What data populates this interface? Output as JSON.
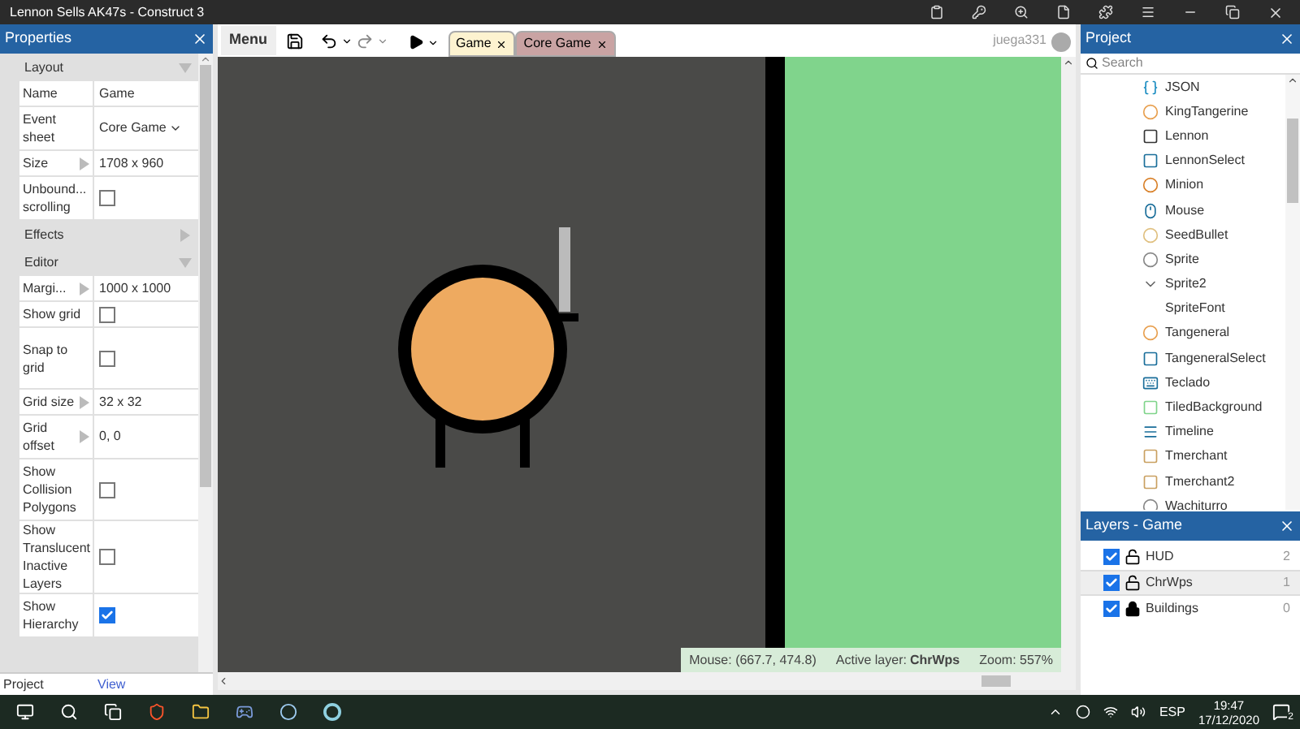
{
  "window": {
    "title": "Lennon Sells AK47s - Construct 3"
  },
  "properties": {
    "title": "Properties",
    "rows": [
      {
        "kind": "section",
        "label": "Layout",
        "expanded": true
      },
      {
        "kind": "text",
        "label": "Name",
        "value": "Game"
      },
      {
        "kind": "dropdown",
        "label": "Event sheet",
        "value": "Core Game"
      },
      {
        "kind": "expander",
        "label": "Size",
        "value": "1708 x 960"
      },
      {
        "kind": "checkbox",
        "label": "Unbound... scrolling",
        "checked": false
      },
      {
        "kind": "section",
        "label": "Effects",
        "expanded": false
      },
      {
        "kind": "section",
        "label": "Editor",
        "expanded": true
      },
      {
        "kind": "expander",
        "label": "Margi...",
        "value": "1000 x 1000"
      },
      {
        "kind": "checkbox",
        "label": "Show grid",
        "checked": false
      },
      {
        "kind": "checkbox",
        "label": "Snap to grid",
        "checked": false
      },
      {
        "kind": "expander",
        "label": "Grid size",
        "value": "32 x 32"
      },
      {
        "kind": "expander",
        "label": "Grid offset",
        "value": "0, 0"
      },
      {
        "kind": "checkbox",
        "label": "Show Collision Polygons",
        "checked": false
      },
      {
        "kind": "checkbox",
        "label": "Show Translucent Inactive Layers",
        "checked": false
      },
      {
        "kind": "checkbox",
        "label": "Show Hierarchy",
        "checked": true
      }
    ],
    "footer": "Project",
    "footer_link": "View"
  },
  "toolbar": {
    "menu": "Menu",
    "tabs": [
      {
        "label": "Game",
        "selected": true
      },
      {
        "label": "Core Game",
        "selected": false
      }
    ],
    "user": "juega331"
  },
  "status_bar": {
    "mouse": "Mouse: (667.7, 474.8)",
    "active_layer_label": "Active layer:",
    "active_layer": "ChrWps",
    "zoom": "Zoom: 557%"
  },
  "project": {
    "title": "Project",
    "search": {
      "placeholder": "Search"
    },
    "items": [
      "JSON",
      "KingTangerine",
      "Lennon",
      "LennonSelect",
      "Minion",
      "Mouse",
      "SeedBullet",
      "Sprite",
      "Sprite2",
      "SpriteFont",
      "Tangeneral",
      "TangeneralSelect",
      "Teclado",
      "TiledBackground",
      "Timeline",
      "Tmerchant",
      "Tmerchant2",
      "Wachiturro"
    ]
  },
  "layers": {
    "title": "Layers - Game",
    "items": [
      {
        "name": "HUD",
        "number": "2",
        "visible": true,
        "locked": false,
        "selected": false
      },
      {
        "name": "ChrWps",
        "number": "1",
        "visible": true,
        "locked": false,
        "selected": true
      },
      {
        "name": "Buildings",
        "number": "0",
        "visible": true,
        "locked": true,
        "selected": false
      }
    ]
  },
  "taskbar": {
    "language": "ESP",
    "time": "19:47",
    "date": "17/12/2020",
    "notifications": "2"
  }
}
